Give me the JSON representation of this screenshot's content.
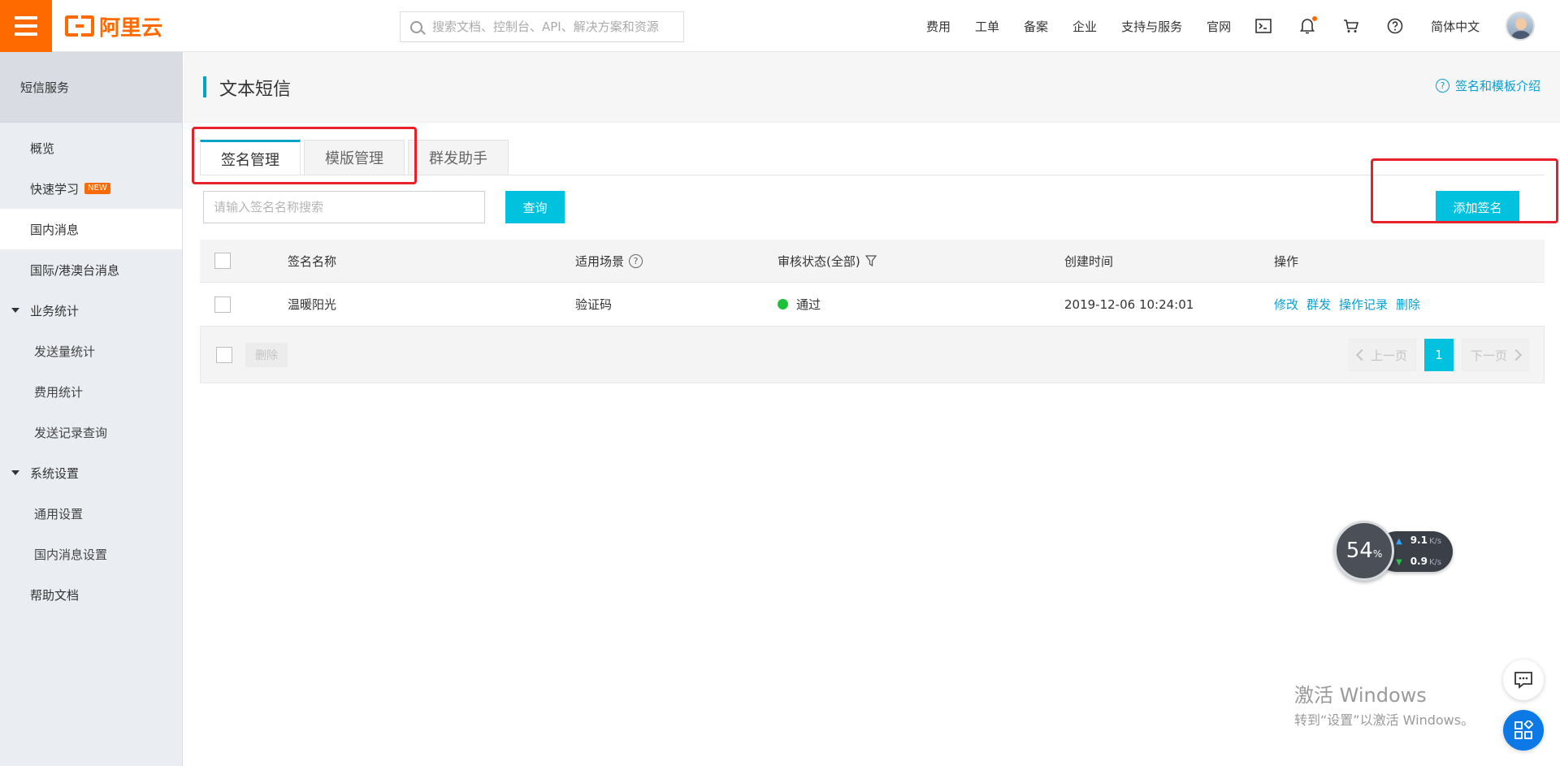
{
  "topbar": {
    "logo_text": "阿里云",
    "search_placeholder": "搜索文档、控制台、API、解决方案和资源",
    "nav_links": [
      "费用",
      "工单",
      "备案",
      "企业",
      "支持与服务",
      "官网"
    ],
    "language": "简体中文",
    "brand_color": "#ff6a00"
  },
  "sidebar": {
    "title": "短信服务",
    "items": {
      "overview": "概览",
      "quick_learn": "快速学习",
      "quick_learn_badge": "NEW",
      "domestic": "国内消息",
      "international": "国际/港澳台消息",
      "business_stats": "业务统计",
      "send_volume": "发送量统计",
      "cost_stats": "费用统计",
      "send_records": "发送记录查询",
      "system_settings": "系统设置",
      "general_settings": "通用设置",
      "domestic_settings": "国内消息设置",
      "help_docs": "帮助文档"
    }
  },
  "main": {
    "page_title": "文本短信",
    "help_link": "签名和模板介绍",
    "tabs": [
      "签名管理",
      "模版管理",
      "群发助手"
    ],
    "search_placeholder": "请输入签名名称搜索",
    "query_button": "查询",
    "add_button": "添加签名",
    "table": {
      "headers": {
        "name": "签名名称",
        "scene": "适用场景",
        "status": "审核状态(全部)",
        "created": "创建时间",
        "ops": "操作"
      },
      "rows": [
        {
          "name": "温暖阳光",
          "scene": "验证码",
          "status": "通过",
          "created": "2019-12-06 10:24:01",
          "ops": [
            "修改",
            "群发",
            "操作记录",
            "删除"
          ]
        }
      ]
    },
    "footer": {
      "delete_button": "删除",
      "prev": "上一页",
      "page": "1",
      "next": "下一页"
    }
  },
  "net_widget": {
    "percent": "54",
    "percent_sign": "%",
    "up_value": "9.1",
    "up_unit": "K/s",
    "down_value": "0.9",
    "down_unit": "K/s"
  },
  "watermark": {
    "line1": "激活 Windows",
    "line2": "转到“设置”以激活 Windows。"
  },
  "accent_color": "#00c1de",
  "status_ok_color": "#1ec13a"
}
